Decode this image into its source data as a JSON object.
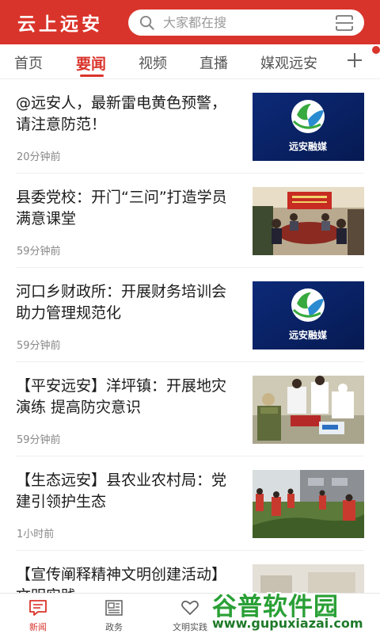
{
  "header": {
    "app_title": "云上远安",
    "search_placeholder": "大家都在搜",
    "accent_color": "#d9342b"
  },
  "tabs": [
    {
      "label": "首页",
      "active": false
    },
    {
      "label": "要闻",
      "active": true
    },
    {
      "label": "视频",
      "active": false
    },
    {
      "label": "直播",
      "active": false
    },
    {
      "label": "媒观远安",
      "active": false
    }
  ],
  "news": [
    {
      "title": "@远安人，最新雷电黄色预警，请注意防范！",
      "time": "20分钟前",
      "image": "远安融媒"
    },
    {
      "title": "县委党校：开门“三问”打造学员满意课堂",
      "time": "59分钟前",
      "image": "meeting-photo"
    },
    {
      "title": "河口乡财政所：开展财务培训会 助力管理规范化",
      "time": "59分钟前",
      "image": "远安融媒"
    },
    {
      "title": "【平安远安】洋坪镇：开展地灾演练 提高防灾意识",
      "time": "59分钟前",
      "image": "drill-photo"
    },
    {
      "title": "【生态远安】县农业农村局：党建引领护生态",
      "time": "1小时前",
      "image": "field-photo"
    },
    {
      "title": "【宣传阐释精神文明创建活动】文明实践……",
      "time": "",
      "image": "partial-photo"
    }
  ],
  "bottom_nav": [
    {
      "label": "新闻",
      "icon": "news-icon",
      "active": true
    },
    {
      "label": "政务",
      "icon": "newspaper-icon",
      "active": false
    },
    {
      "label": "文明实践",
      "icon": "heart-icon",
      "active": false
    }
  ],
  "watermark": {
    "title": "谷普软件园",
    "url": "www.gupuxiazai.com"
  }
}
